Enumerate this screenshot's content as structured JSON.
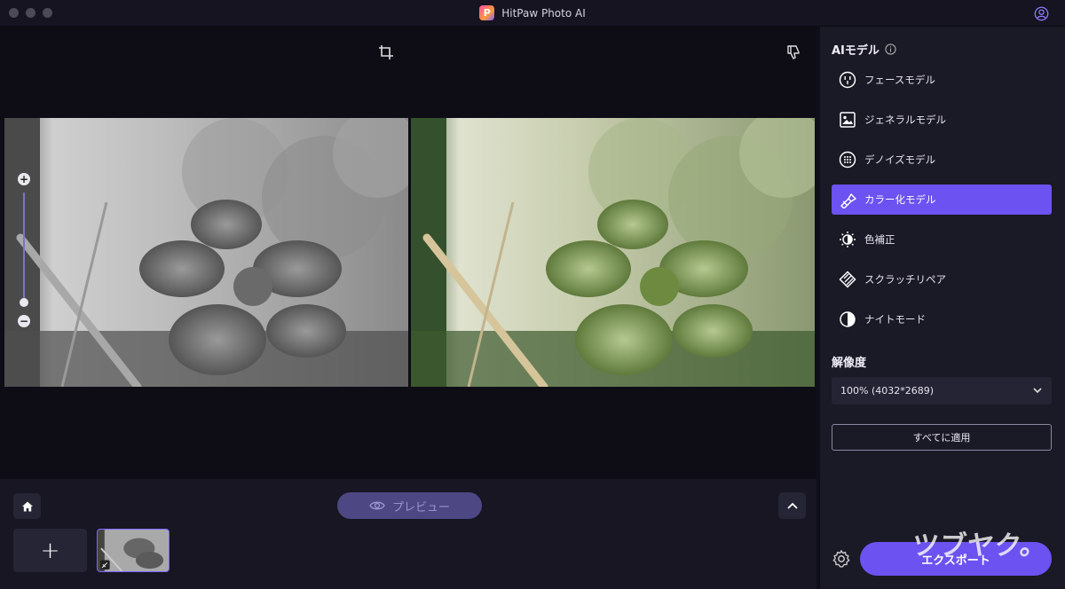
{
  "window": {
    "title": "HitPaw Photo AI"
  },
  "sidebar": {
    "ai_model_title": "AIモデル",
    "models": [
      {
        "label": "フェースモデル",
        "icon": "face-model-icon",
        "active": false
      },
      {
        "label": "ジェネラルモデル",
        "icon": "general-model-icon",
        "active": false
      },
      {
        "label": "デノイズモデル",
        "icon": "denoise-model-icon",
        "active": false
      },
      {
        "label": "カラー化モデル",
        "icon": "colorize-model-icon",
        "active": true
      },
      {
        "label": "色補正",
        "icon": "color-correction-icon",
        "active": false
      },
      {
        "label": "スクラッチリペア",
        "icon": "scratch-repair-icon",
        "active": false
      },
      {
        "label": "ナイトモード",
        "icon": "night-mode-icon",
        "active": false
      }
    ],
    "resolution_title": "解像度",
    "resolution_value": "100% (4032*2689)",
    "apply_all_label": "すべてに適用",
    "export_label": "エクスポート"
  },
  "bottom": {
    "preview_label": "プレビュー",
    "add_label": "+"
  },
  "watermark": "ツブヤク。",
  "colors": {
    "accent": "#6c52f0",
    "sidebar_bg": "#1a1926",
    "canvas_bg": "#0e0d16"
  }
}
